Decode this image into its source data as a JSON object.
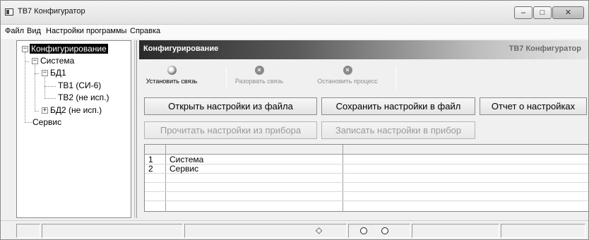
{
  "window": {
    "title": "ТВ7 Конфигуратор",
    "controls": {
      "minimize": "–",
      "maximize": "□",
      "close": "✕"
    }
  },
  "menu": [
    "Файл",
    "Вид",
    "Настройки программы",
    "Справка"
  ],
  "tree": {
    "root": "Конфигурирование",
    "system": "Система",
    "bd1": "БД1",
    "tv1": "ТВ1 (СИ-6)",
    "tv2": "ТВ2 (не исп.)",
    "bd2": "БД2 (не исп.)",
    "service": "Сервис",
    "expand_minus": "−",
    "expand_plus": "+"
  },
  "panel": {
    "title": "Конфигурирование",
    "app_name": "ТВ7 Конфигуратор"
  },
  "toolbar": {
    "connect": {
      "label": "Установить связь",
      "icon": "globe-icon",
      "enabled": true
    },
    "disconnect": {
      "label": "Разорвать связь",
      "icon": "stop-icon",
      "enabled": false
    },
    "stop_process": {
      "label": "Остановить процесс",
      "icon": "stop-icon",
      "enabled": false
    },
    "stop_glyph": "×"
  },
  "buttons": {
    "open_file": "Открыть настройки из файла",
    "save_file": "Сохранить настройки в файл",
    "report": "Отчет о настройках",
    "read_device": "Прочитать настройки из прибора",
    "write_device": "Записать настройки в прибор"
  },
  "grid": {
    "rows": [
      {
        "num": "1",
        "name": "Система"
      },
      {
        "num": "2",
        "name": "Сервис"
      }
    ]
  },
  "statusbar": {
    "indicator_glyph": "◇"
  },
  "colors": {
    "panel_header_dark": "#2a2a2a",
    "selection": "#000000",
    "disabled_text": "#8e8e8e"
  }
}
